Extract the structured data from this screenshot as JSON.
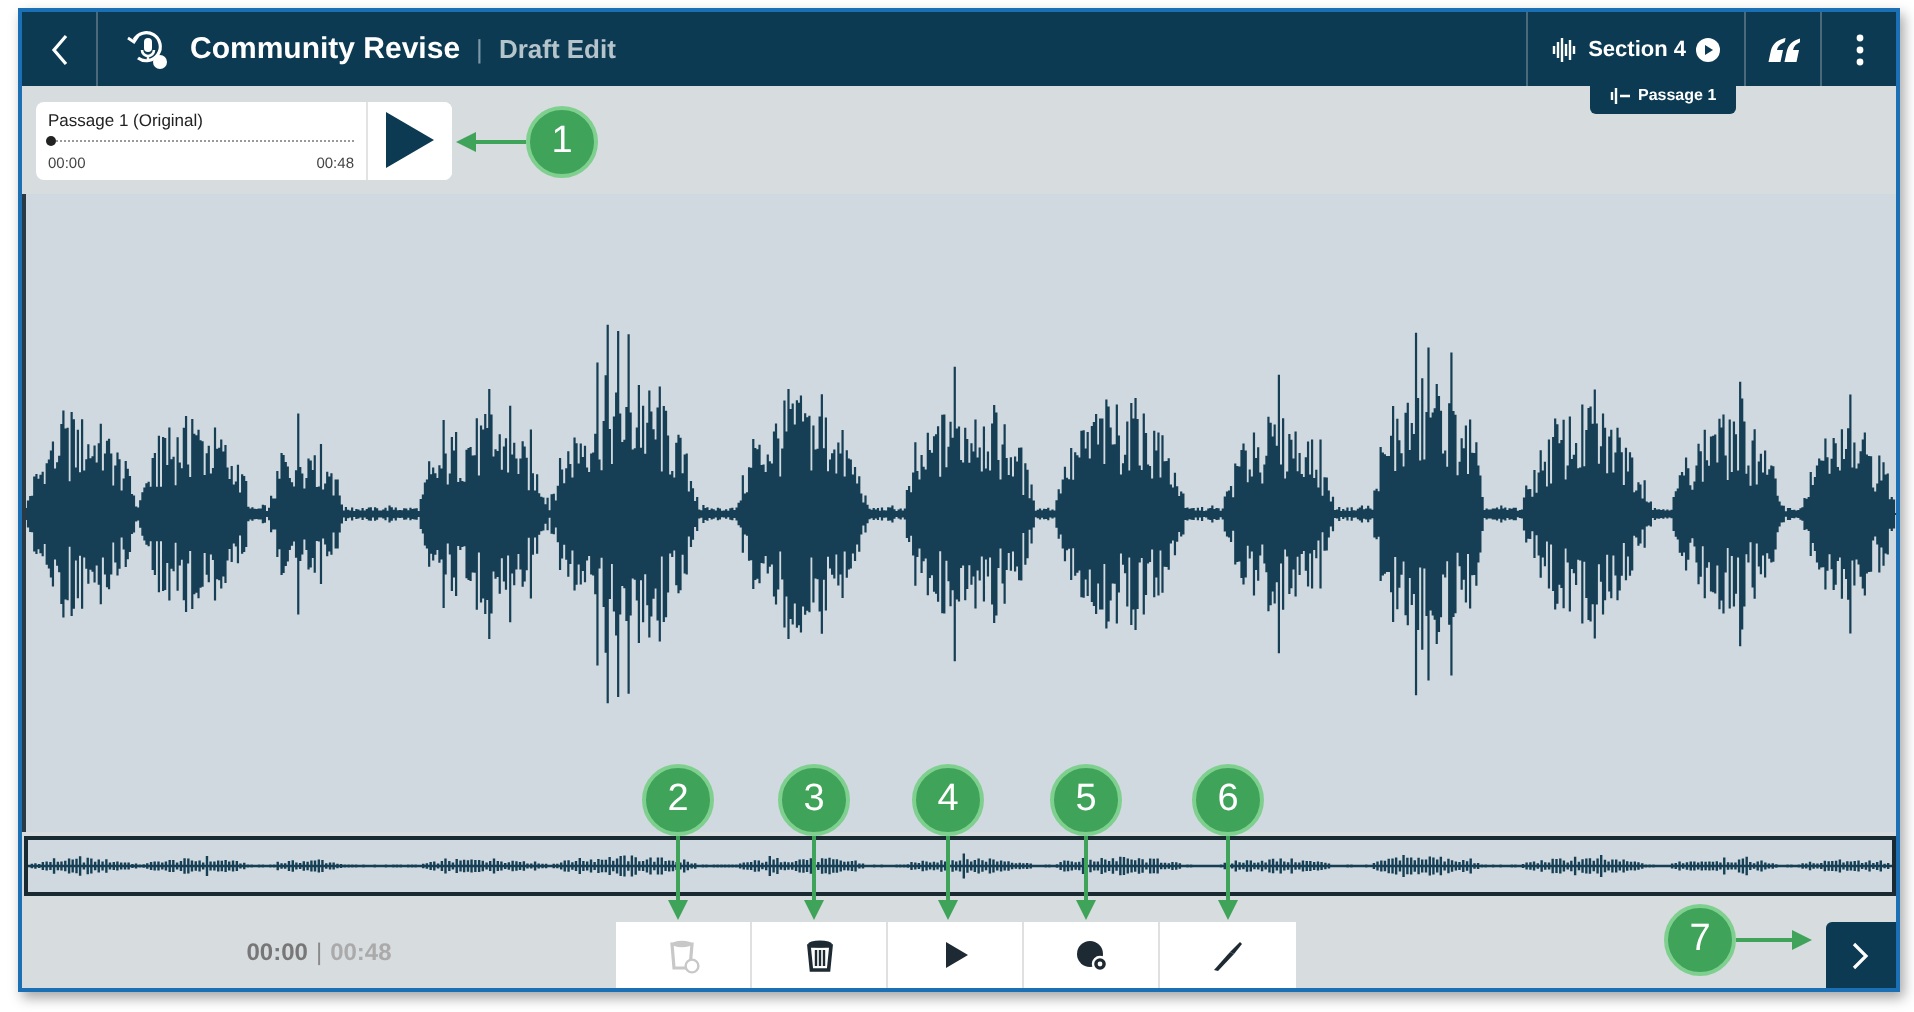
{
  "header": {
    "title": "Community Revise",
    "separator": "|",
    "subtitle": "Draft Edit",
    "section_button": "Section 4",
    "tooltip": "Passage 1"
  },
  "player": {
    "title": "Passage 1 (Original)",
    "start": "00:00",
    "end": "00:48",
    "level": 0
  },
  "timer": {
    "current": "00:00",
    "separator": "|",
    "total": "00:48"
  },
  "tools": [
    {
      "kind": "restore",
      "disabled": true
    },
    {
      "kind": "delete",
      "disabled": false
    },
    {
      "kind": "play",
      "disabled": false
    },
    {
      "kind": "record",
      "disabled": false
    },
    {
      "kind": "split",
      "disabled": false
    }
  ],
  "callouts": [
    {
      "label": "1"
    },
    {
      "label": "2"
    },
    {
      "label": "3"
    },
    {
      "label": "4"
    },
    {
      "label": "5"
    },
    {
      "label": "6"
    },
    {
      "label": "7"
    }
  ]
}
